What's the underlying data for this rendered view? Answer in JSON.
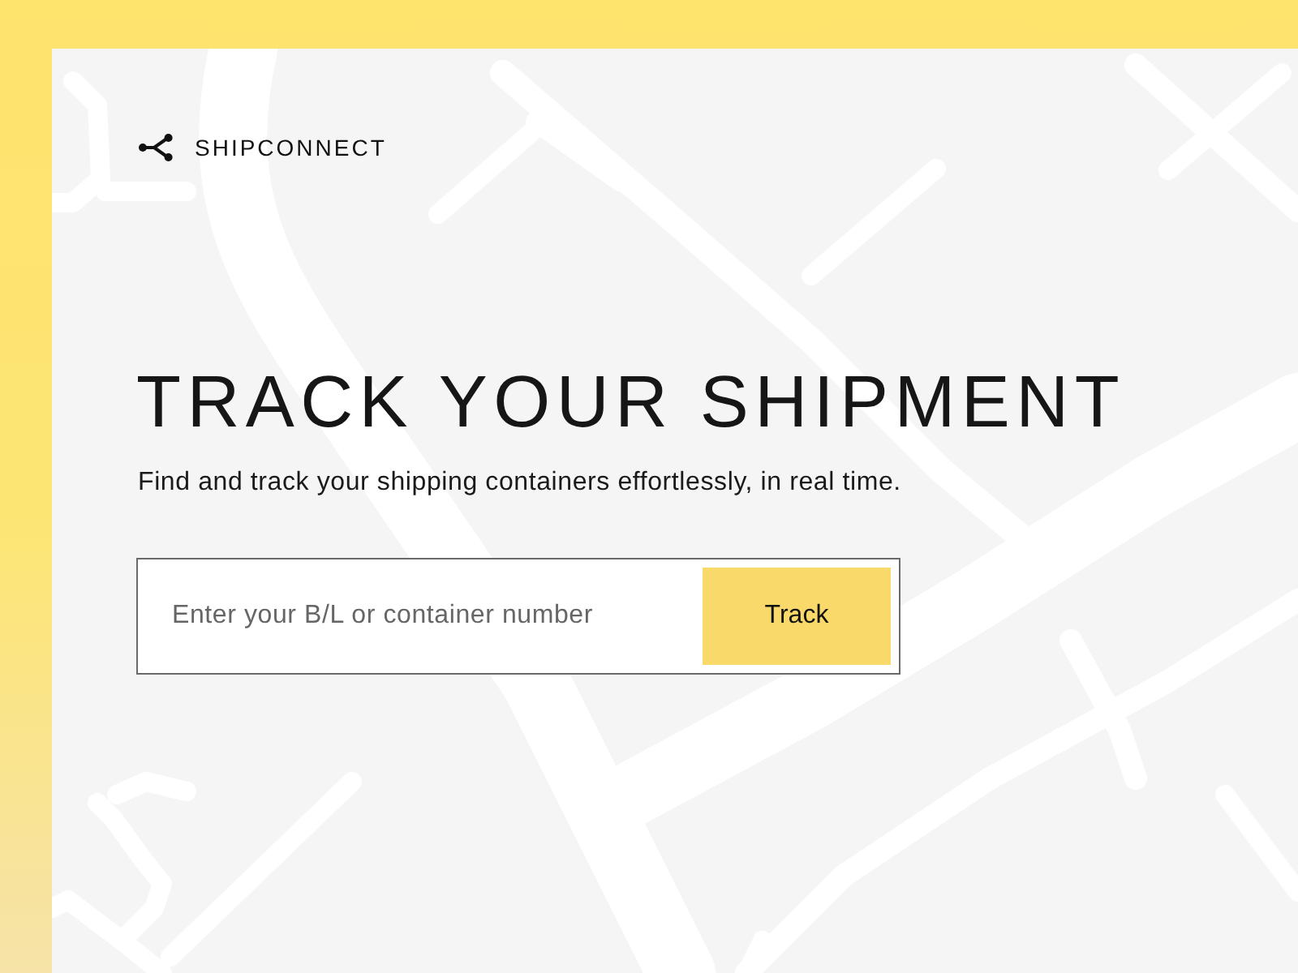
{
  "brand": {
    "name": "SHIPCONNECT"
  },
  "hero": {
    "title": "TRACK YOUR SHIPMENT",
    "subtitle": "Find and track your shipping containers effortlessly, in real time."
  },
  "search": {
    "placeholder": "Enter your B/L or container number",
    "button": "Track"
  }
}
